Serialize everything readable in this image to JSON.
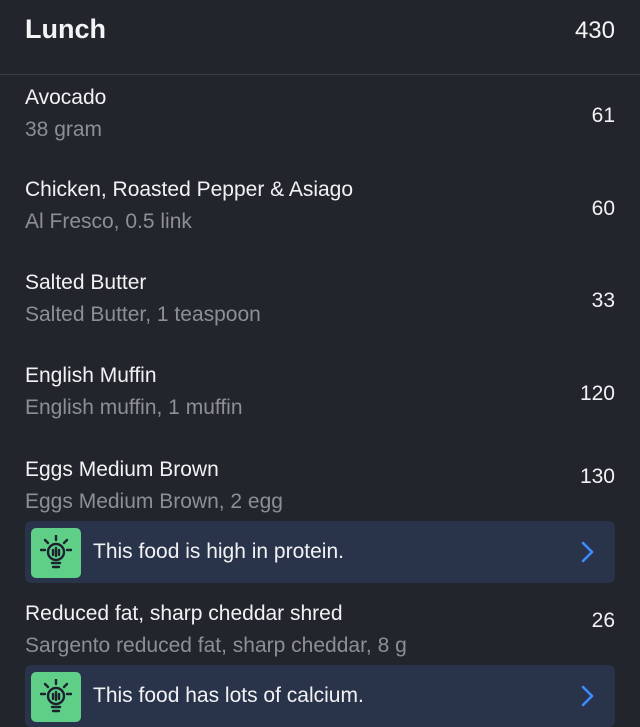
{
  "meal": {
    "title": "Lunch",
    "total_calories": "430"
  },
  "foods": [
    {
      "name": "Avocado",
      "detail": "38 gram",
      "calories": "61"
    },
    {
      "name": "Chicken, Roasted Pepper & Asiago",
      "detail": "Al Fresco, 0.5 link",
      "calories": "60"
    },
    {
      "name": "Salted Butter",
      "detail": "Salted Butter, 1 teaspoon",
      "calories": "33"
    },
    {
      "name": "English Muffin",
      "detail": "English muffin, 1 muffin",
      "calories": "120"
    },
    {
      "name": "Eggs Medium Brown",
      "detail": "Eggs Medium Brown, 2 egg",
      "calories": "130",
      "tip": {
        "text": "This food is high in protein.",
        "icon": "lightbulb-icon"
      }
    },
    {
      "name": "Reduced fat, sharp cheddar shred",
      "detail": "Sargento reduced fat, sharp cheddar, 8 g",
      "calories": "26",
      "tip": {
        "text": "This food has lots of calcium.",
        "icon": "lightbulb-icon"
      }
    }
  ],
  "colors": {
    "background": "#23252c",
    "tip_background": "#29344a",
    "badge_green": "#5fcf88",
    "chevron_blue": "#3d8bff",
    "secondary_text": "#8d8f97"
  }
}
